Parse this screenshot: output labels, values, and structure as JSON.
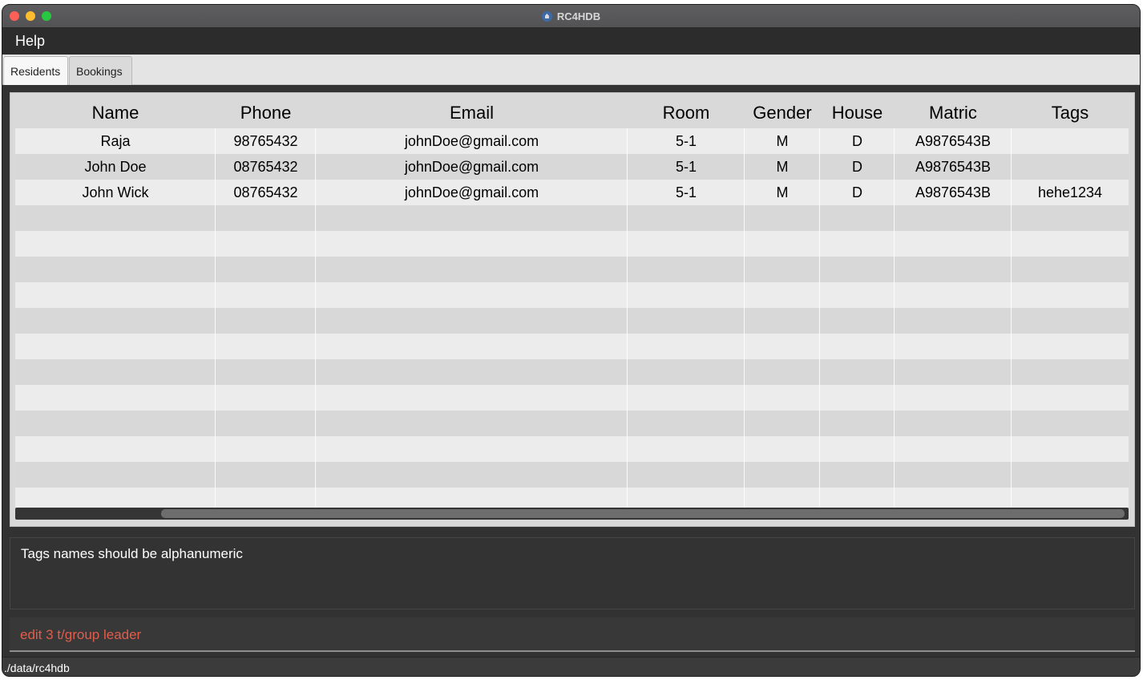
{
  "window": {
    "title": "RC4HDB"
  },
  "menu": {
    "help": "Help"
  },
  "tabs": [
    {
      "label": "Residents",
      "active": true
    },
    {
      "label": "Bookings",
      "active": false
    }
  ],
  "table": {
    "columns": [
      "Name",
      "Phone",
      "Email",
      "Room",
      "Gender",
      "House",
      "Matric",
      "Tags"
    ],
    "rows": [
      [
        "Raja",
        "98765432",
        "johnDoe@gmail.com",
        "5-1",
        "M",
        "D",
        "A9876543B",
        ""
      ],
      [
        "John Doe",
        "08765432",
        "johnDoe@gmail.com",
        "5-1",
        "M",
        "D",
        "A9876543B",
        ""
      ],
      [
        "John Wick",
        "08765432",
        "johnDoe@gmail.com",
        "5-1",
        "M",
        "D",
        "A9876543B",
        "hehe1234"
      ]
    ]
  },
  "result": {
    "message": "Tags names should be alphanumeric"
  },
  "command": {
    "value": "edit 3 t/group leader"
  },
  "status": {
    "path": "./data/rc4hdb"
  },
  "colors": {
    "command_text": "#e05d4c",
    "background": "#323232"
  },
  "icons": {
    "app": "house-icon"
  }
}
